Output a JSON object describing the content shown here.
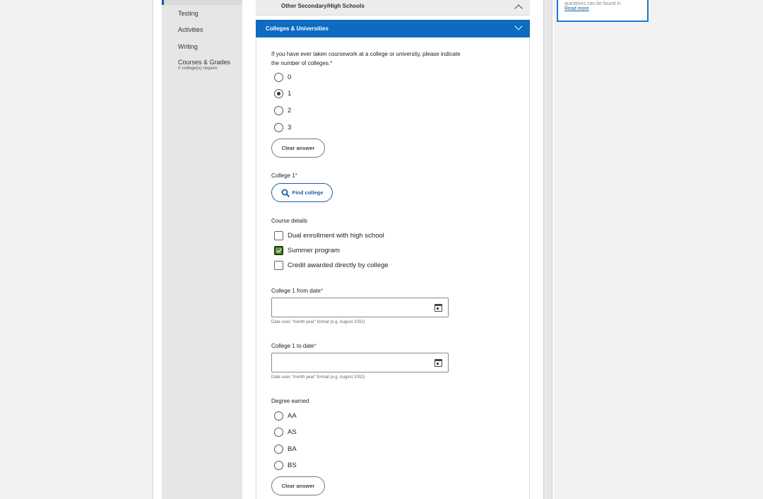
{
  "sidebar": {
    "items": [
      {
        "label": "Testing"
      },
      {
        "label": "Activities"
      },
      {
        "label": "Writing"
      },
      {
        "label": "Courses & Grades",
        "sublabel": "0 college(s) require"
      }
    ]
  },
  "accordion": {
    "other_title": "Other Secondary/High Schools",
    "colleges_title": "Colleges & Universities"
  },
  "question": {
    "text_line1": "If you have ever taken coursework at a college or university, please indicate",
    "text_line2": "the number of colleges.",
    "required_mark": "*",
    "options": [
      "0",
      "1",
      "2",
      "3"
    ],
    "selected": "1",
    "clear_label": "Clear answer"
  },
  "college": {
    "label": "College 1",
    "required_mark": "*",
    "find_label": "Find college"
  },
  "course_details": {
    "label": "Course details",
    "options": [
      {
        "label": "Dual enrollment with high school",
        "checked": false
      },
      {
        "label": "Summer program",
        "checked": true
      },
      {
        "label": "Credit awarded directly by college",
        "checked": false
      }
    ]
  },
  "from_date": {
    "label": "College 1 from date",
    "required_mark": "*",
    "value": "",
    "hint": "Date uses \"month year\" format (e.g. August 2002)"
  },
  "to_date": {
    "label": "College 1 to date",
    "required_mark": "*",
    "value": "",
    "hint": "Date uses \"month year\" format (e.g. August 2002)"
  },
  "degree": {
    "label": "Degree earned",
    "options": [
      "AA",
      "AS",
      "BA",
      "BS"
    ],
    "selected": null,
    "clear_label": "Clear answer"
  },
  "info_box": {
    "text": "questions can be found in",
    "link": "Read more"
  },
  "colors": {
    "accent_blue": "#0d6bc2",
    "check_green": "#5b9e3a",
    "required_red": "#c8102e"
  }
}
